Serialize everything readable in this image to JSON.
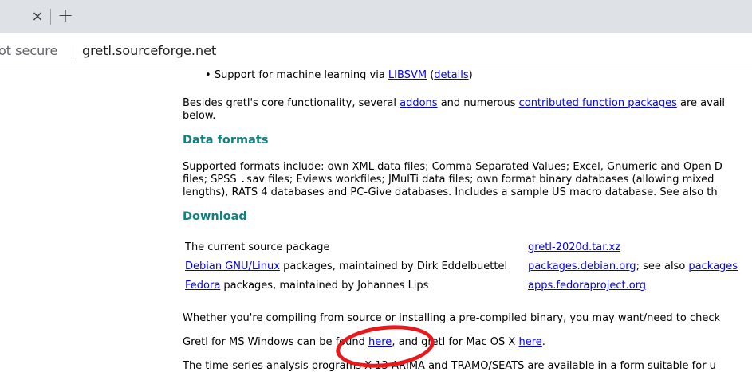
{
  "browser": {
    "tab_close_glyph": "×",
    "new_tab_glyph": "+",
    "security_label": "ot secure",
    "url": "gretl.sourceforge.net"
  },
  "page": {
    "bullet_text": "Support for machine learning via ",
    "bullet_link_libsvm": "LIBSVM",
    "bullet_paren_open": " (",
    "bullet_link_details": "details",
    "bullet_paren_close": ")",
    "addons_text_1": "Besides gretl's core functionality, several ",
    "addons_link": "addons",
    "addons_text_2": " and numerous ",
    "contrib_link": "contributed function packages",
    "addons_text_3": " are avail",
    "addons_text_4": "below.",
    "heading_formats": "Data formats",
    "formats_line1": "Supported formats include: own XML data files; Comma Separated Values; Excel, Gnumeric and Open D",
    "formats_line2_a": "files; SPSS ",
    "formats_line2_mono": ".sav",
    "formats_line2_b": " files; Eviews workfiles; JMulTi data files; own format binary databases (allowing mixed",
    "formats_line3": "lengths), RATS 4 databases and PC-Give databases. Includes a sample US macro database. See also th",
    "heading_download": "Download",
    "download_rows": [
      {
        "col1_link": "",
        "col1_text": "The current source package",
        "col2_link": "gretl-2020d.tar.xz",
        "col2_text": "",
        "col2_link2": ""
      },
      {
        "col1_link": "Debian GNU/Linux",
        "col1_text": " packages, maintained by Dirk Eddelbuettel",
        "col2_link": "packages.debian.org",
        "col2_text": "; see also ",
        "col2_link2": "packages"
      },
      {
        "col1_link": "Fedora",
        "col1_text": " packages, maintained by Johannes Lips",
        "col2_link": "apps.fedoraproject.org",
        "col2_text": "",
        "col2_link2": ""
      }
    ],
    "compile_text": "Whether you're compiling from source or installing a pre-compiled binary, you may want/need to check",
    "windows_text_1": "Gretl for MS Windows can be found ",
    "windows_link": "here",
    "windows_text_2": ", and gretl for Mac OS X ",
    "mac_link": "here",
    "windows_text_3": ".",
    "timeseries_text": "The time-series analysis programs X-13-ARIMA and TRAMO/SEATS are available in a form suitable for u"
  },
  "colors": {
    "heading": "#108080",
    "link": "#0000ee",
    "annotation_ring": "#e8191c",
    "tabstrip": "#dee1e6"
  }
}
